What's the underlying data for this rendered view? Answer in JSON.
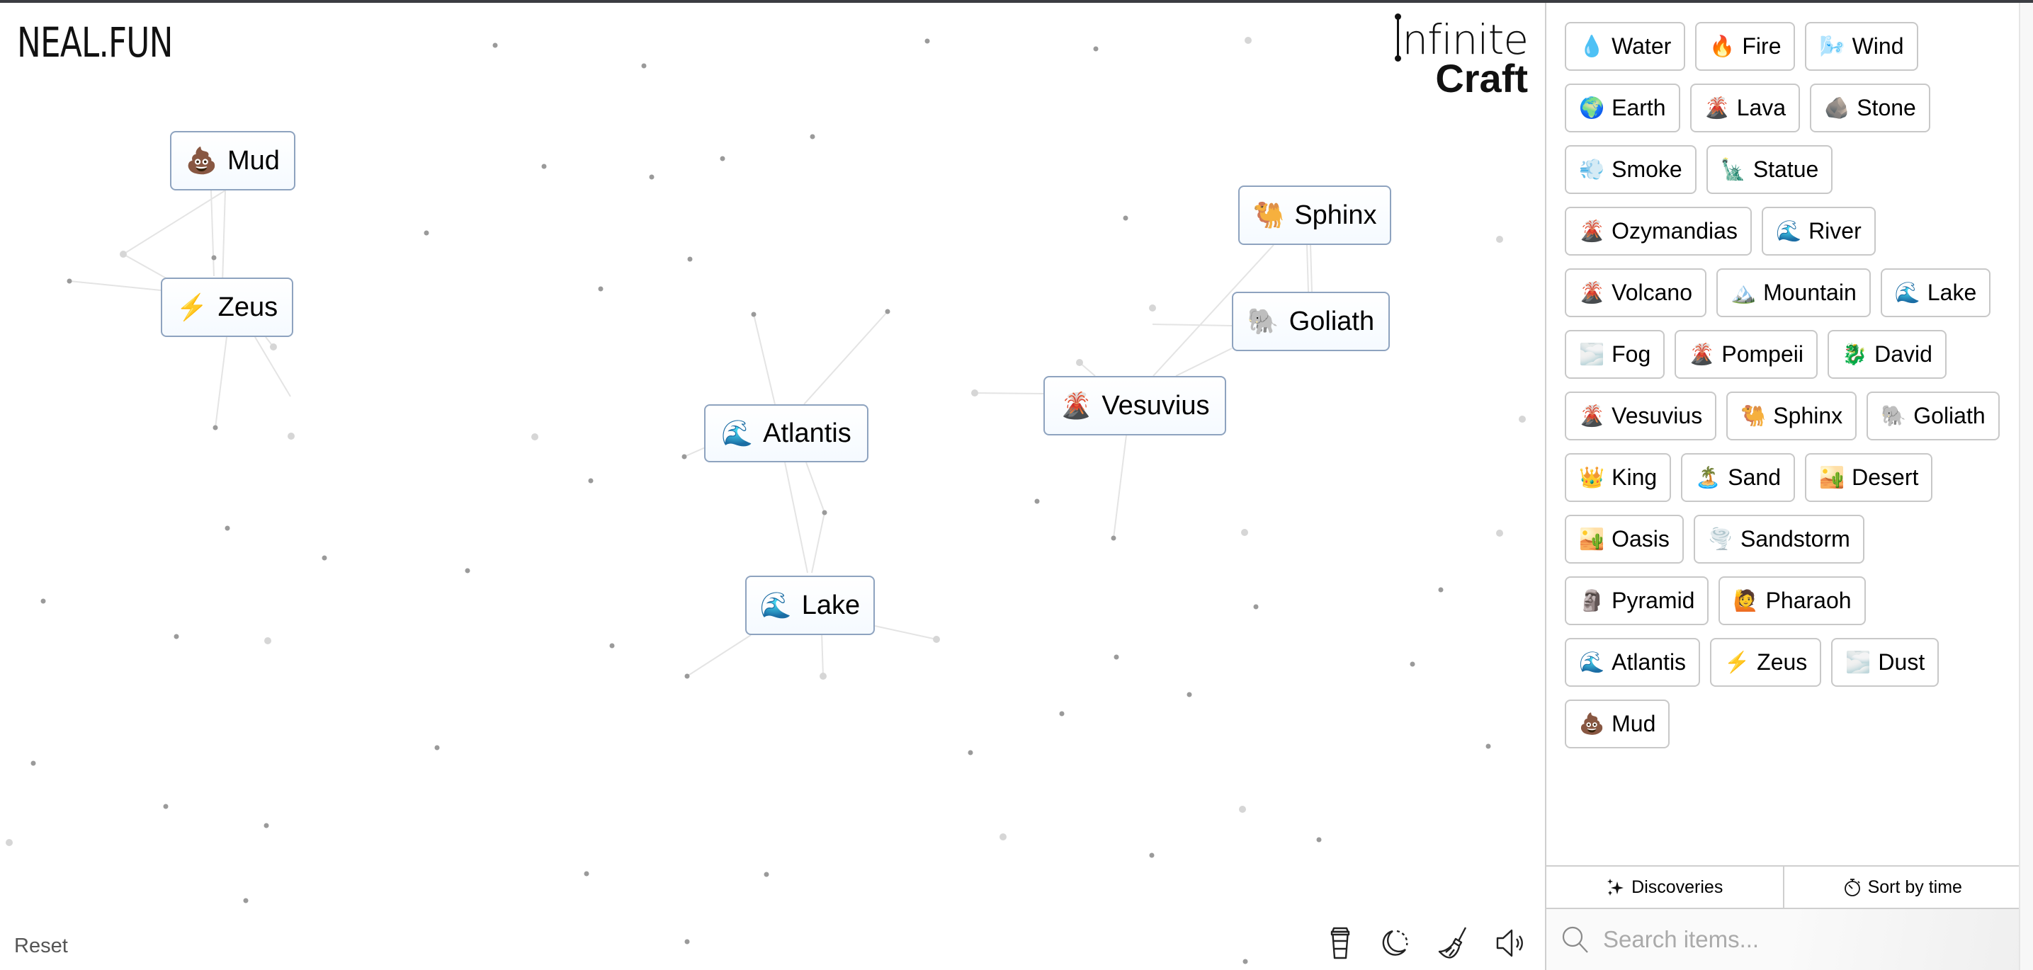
{
  "logo": "NEAL.FUN",
  "brand": {
    "line1": "nfinite",
    "line2": "Craft"
  },
  "canvas_items": [
    {
      "emoji": "💩",
      "label": "Mud"
    },
    {
      "emoji": "⚡",
      "label": "Zeus"
    },
    {
      "emoji": "🌊",
      "label": "Atlantis"
    },
    {
      "emoji": "🌊",
      "label": "Lake"
    },
    {
      "emoji": "🌋",
      "label": "Vesuvius"
    },
    {
      "emoji": "🐫",
      "label": "Sphinx"
    },
    {
      "emoji": "🐘",
      "label": "Goliath"
    }
  ],
  "toolbar": {
    "reset_label": "Reset",
    "icons": [
      "coffee-cup-icon",
      "dark-mode-icon",
      "broom-icon",
      "sound-icon"
    ]
  },
  "sidebar": {
    "items": [
      {
        "emoji": "💧",
        "label": "Water"
      },
      {
        "emoji": "🔥",
        "label": "Fire"
      },
      {
        "emoji": "🌬️",
        "label": "Wind"
      },
      {
        "emoji": "🌍",
        "label": "Earth"
      },
      {
        "emoji": "🌋",
        "label": "Lava"
      },
      {
        "emoji": "🪨",
        "label": "Stone"
      },
      {
        "emoji": "💨",
        "label": "Smoke"
      },
      {
        "emoji": "🗽",
        "label": "Statue"
      },
      {
        "emoji": "🌋",
        "label": "Ozymandias"
      },
      {
        "emoji": "🌊",
        "label": "River"
      },
      {
        "emoji": "🌋",
        "label": "Volcano"
      },
      {
        "emoji": "🏔️",
        "label": "Mountain"
      },
      {
        "emoji": "🌊",
        "label": "Lake"
      },
      {
        "emoji": "🌫️",
        "label": "Fog"
      },
      {
        "emoji": "🌋",
        "label": "Pompeii"
      },
      {
        "emoji": "🐉",
        "label": "David"
      },
      {
        "emoji": "🌋",
        "label": "Vesuvius"
      },
      {
        "emoji": "🐫",
        "label": "Sphinx"
      },
      {
        "emoji": "🐘",
        "label": "Goliath"
      },
      {
        "emoji": "👑",
        "label": "King"
      },
      {
        "emoji": "🏝️",
        "label": "Sand"
      },
      {
        "emoji": "🏜️",
        "label": "Desert"
      },
      {
        "emoji": "🏜️",
        "label": "Oasis"
      },
      {
        "emoji": "🌪️",
        "label": "Sandstorm"
      },
      {
        "emoji": "🗿",
        "label": "Pyramid"
      },
      {
        "emoji": "🙋",
        "label": "Pharaoh"
      },
      {
        "emoji": "🌊",
        "label": "Atlantis"
      },
      {
        "emoji": "⚡",
        "label": "Zeus"
      },
      {
        "emoji": "🌫️",
        "label": "Dust"
      },
      {
        "emoji": "💩",
        "label": "Mud"
      }
    ],
    "tabs": [
      {
        "icon": "sparkles-icon",
        "label": "Discoveries"
      },
      {
        "icon": "stopwatch-icon",
        "label": "Sort by time"
      }
    ],
    "search": {
      "placeholder": "Search items...",
      "value": ""
    }
  }
}
